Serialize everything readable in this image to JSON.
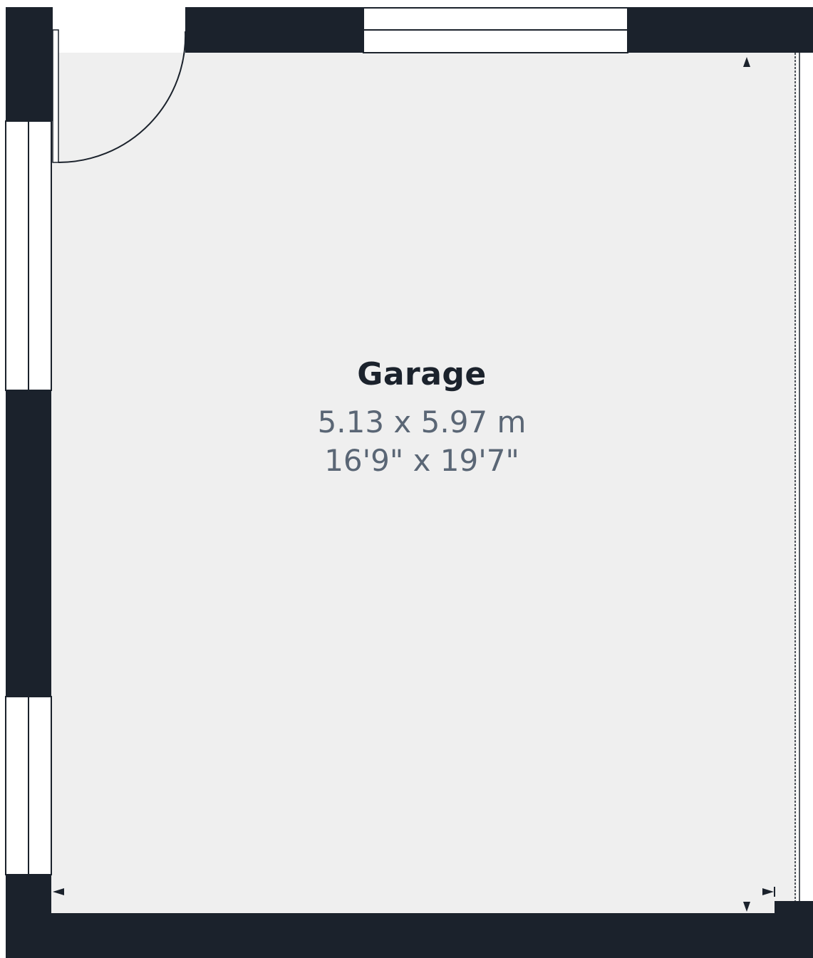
{
  "room": {
    "name": "Garage",
    "metric": "5.13 x 5.97 m",
    "imperial": "16'9\" x 19'7\""
  },
  "colors": {
    "wall": "#1b222c",
    "floor": "#efefef",
    "window": "#ffffff",
    "line": "#1b222c"
  },
  "icons": [
    "dimension-arrow-icon"
  ]
}
